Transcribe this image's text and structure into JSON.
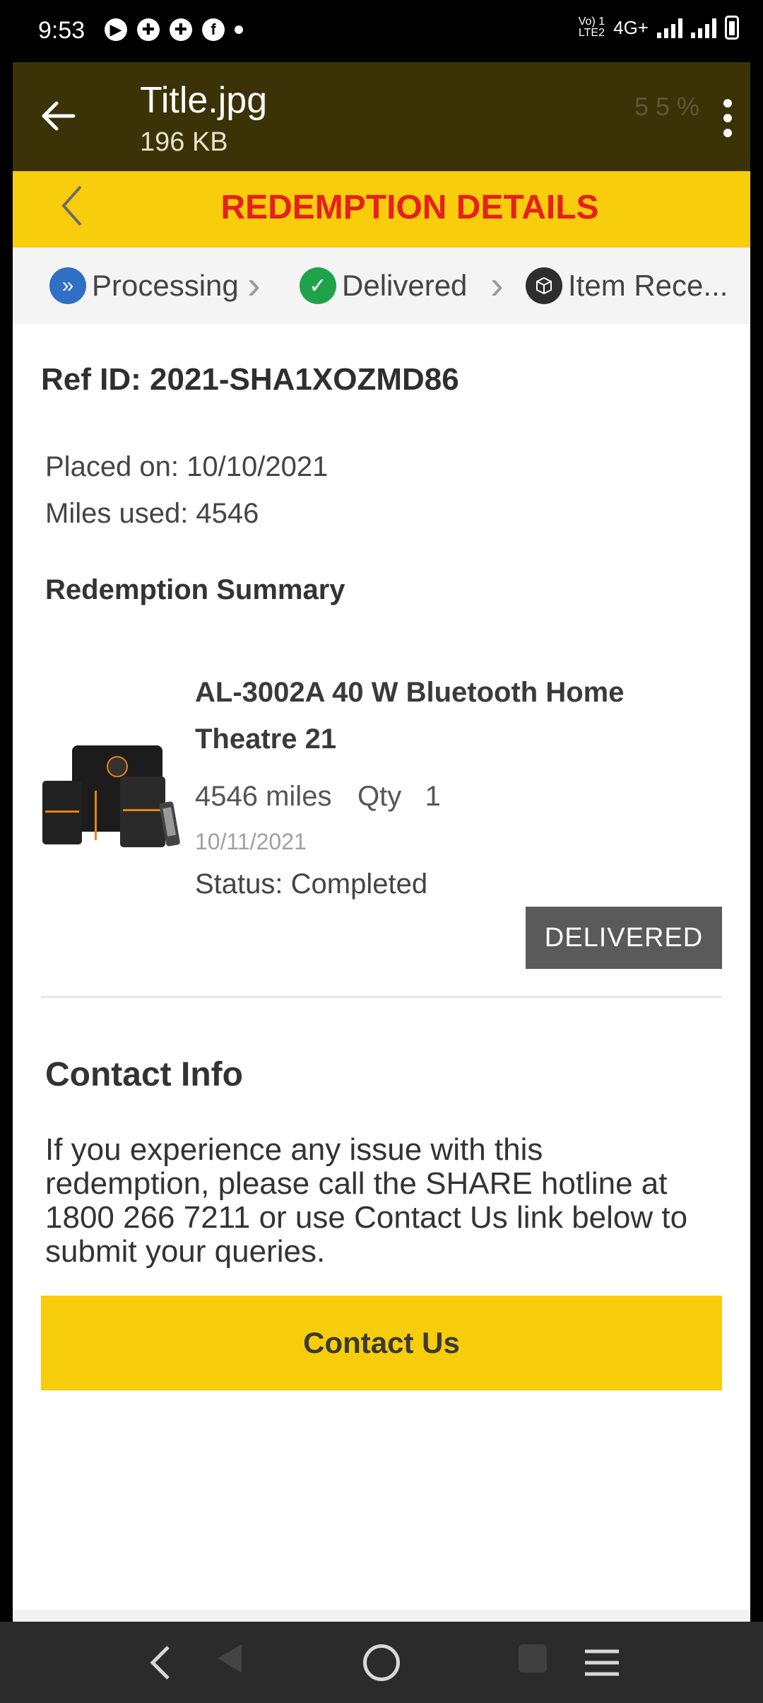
{
  "status_bar": {
    "time": "9:53",
    "network_label_top": "Vo) 1",
    "network_label_bottom": "LTE2",
    "network_type": "4G+",
    "notification_icons": [
      "play-icon",
      "game-controller-icon",
      "game-controller-icon",
      "facebook-icon"
    ]
  },
  "viewer": {
    "title": "Title.jpg",
    "file_size": "196 KB",
    "ghost_status": "55%"
  },
  "header": {
    "title": "REDEMPTION DETAILS"
  },
  "tracker": {
    "steps": [
      {
        "label": "Processing",
        "icon": "double-chevron-icon",
        "color": "#2f6fc4"
      },
      {
        "label": "Delivered",
        "icon": "check-icon",
        "color": "#1fa34a"
      },
      {
        "label": "Item Rece...",
        "icon": "box-icon",
        "color": "#2e2e2e"
      }
    ]
  },
  "order": {
    "ref_id": "Ref ID: 2021-SHA1XOZMD86",
    "placed_on": "Placed on: 10/10/2021",
    "miles_used": "Miles used: 4546",
    "summary_title": "Redemption Summary"
  },
  "item": {
    "name": "AL-3002A 40 W Bluetooth Home Theatre 21",
    "miles": "4546 miles",
    "qty": "Qty   1",
    "date": "10/11/2021",
    "status": "Status: Completed",
    "badge": "DELIVERED"
  },
  "contact": {
    "title": "Contact Info",
    "text": "If you experience any issue with this redemption, please call the SHARE hotline at 1800 266 7211 or use Contact Us link below to submit your queries.",
    "button": "Contact Us"
  },
  "colors": {
    "brand_yellow": "#f8cd0c",
    "title_red": "#e62020",
    "viewer_bar": "#3c3208",
    "badge_gray": "#5a5a5a"
  }
}
